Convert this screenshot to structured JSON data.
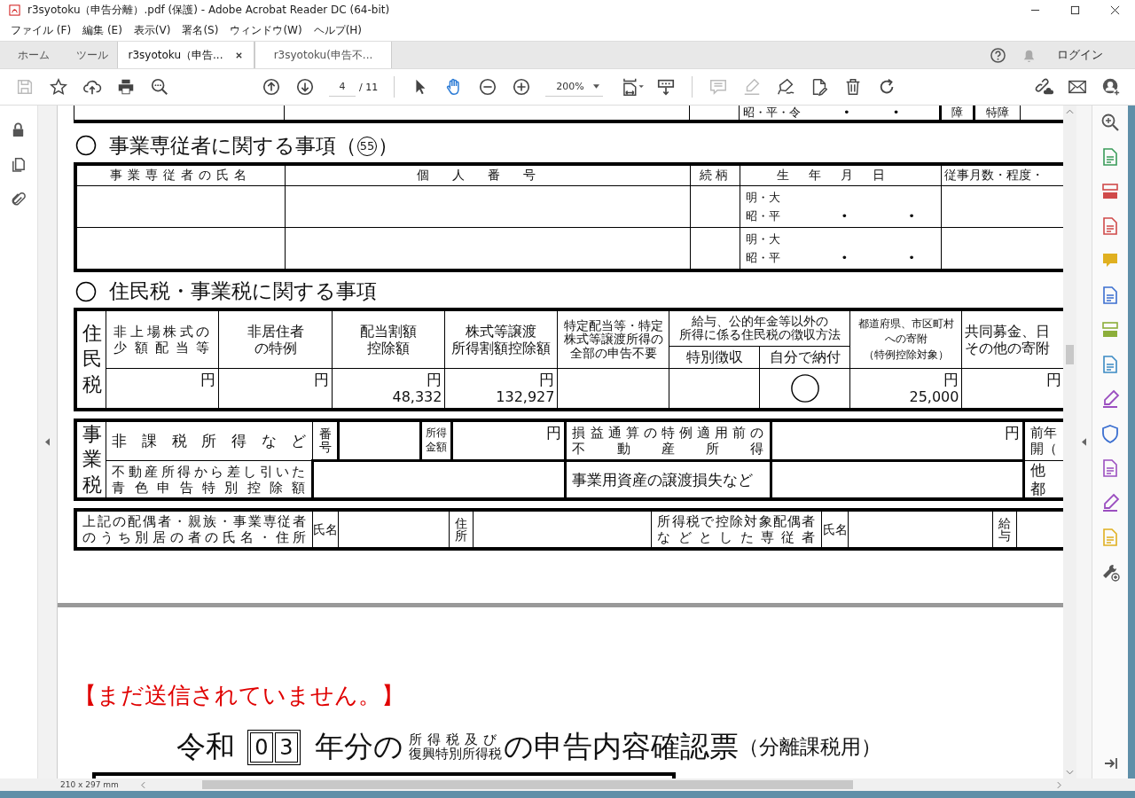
{
  "window": {
    "title": "r3syotoku（申告分離）.pdf (保護) - Adobe Acrobat Reader DC (64-bit)"
  },
  "menu": [
    "ファイル (F)",
    "編集 (E)",
    "表示(V)",
    "署名(S)",
    "ウィンドウ(W)",
    "ヘルプ(H)"
  ],
  "tabs": [
    {
      "label": "ホーム",
      "kind": "nav",
      "selected": false
    },
    {
      "label": "ツール",
      "kind": "nav",
      "selected": false
    },
    {
      "label": "r3syotoku（申告...",
      "kind": "doc",
      "selected": true
    },
    {
      "label": "r3syotoku(申告不...",
      "kind": "doc",
      "selected": false
    }
  ],
  "account": {
    "login": "ログイン"
  },
  "toolbar": {
    "page_number": "4",
    "page_count": "/ 11",
    "zoom": "200%",
    "tools": [
      {
        "kind": "select",
        "selected": false
      },
      {
        "kind": "hand",
        "selected": true
      }
    ]
  },
  "document": {
    "prev_row": {
      "era": "昭・平・令",
      "dots": [
        "•",
        "•"
      ],
      "flags": [
        "障",
        "特障"
      ]
    },
    "employees": {
      "title": "事業専従者に関する事項（",
      "ref": "55",
      "title_end": "）",
      "columns": [
        "事業専従者の氏名",
        "個人番号",
        "続柄",
        "生年月日",
        "従事月数・程度・"
      ],
      "rows": [
        {
          "era_1": "明・大",
          "era_2": "昭・平",
          "dots": [
            "•",
            "•"
          ]
        },
        {
          "era_1": "明・大",
          "era_2": "昭・平",
          "dots": [
            "•",
            "•"
          ]
        }
      ]
    },
    "local_tax": {
      "title": "住民税・事業税に関する事項",
      "resident": {
        "label": "住民税",
        "columns": [
          {
            "kind": "amount",
            "label": [
              "非上場株式の",
              "少額配当等"
            ],
            "unit": "円"
          },
          {
            "kind": "amount",
            "label": [
              "非居住者",
              "の特例"
            ],
            "unit": "円"
          },
          {
            "kind": "amount",
            "label": [
              "配当割額",
              "控除額"
            ],
            "unit": "円",
            "amount": "48,332"
          },
          {
            "kind": "amount",
            "label": [
              "株式等譲渡",
              "所得割額控除額"
            ],
            "unit": "円",
            "amount": "132,927"
          },
          {
            "kind": "check",
            "label": [
              "特定配当等・特定",
              "株式等譲渡所得の",
              "全部の申告不要"
            ]
          },
          {
            "kind": "choice",
            "label": [
              "給与、公的年金等以外の",
              "所得に係る住民税の徴収方法"
            ],
            "options": [
              {
                "label": "特別徴収",
                "circled": false
              },
              {
                "label": "自分で納付",
                "circled": true
              }
            ]
          },
          {
            "kind": "amount",
            "label": [
              "都道府県、市区町村",
              "への寄附",
              "（特例控除対象）"
            ],
            "unit": "円",
            "amount": "25,000"
          },
          {
            "kind": "amount",
            "label": [
              "共同募金、日",
              "その他の寄附"
            ],
            "unit": "円"
          }
        ]
      },
      "business": {
        "label": "事業税",
        "exempt_label": "非課税所得など",
        "number_label": "番号",
        "income_label": [
          "所得",
          "金額"
        ],
        "income_unit": "円",
        "pre_offset_label": [
          "損益通算の特例適用前の",
          "不動産所得"
        ],
        "pre_offset_unit": "円",
        "prev_year_label": [
          "前年",
          "開（"
        ],
        "blue_deduction_label": [
          "不動産所得から差し引いた",
          "青色申告特別控除額"
        ],
        "asset_loss_label": "事業用資産の譲渡損失など",
        "other_label": "他都"
      },
      "separate": {
        "label": [
          "上記の配偶者・親族・事業専従者",
          "のうち別居の者の氏名・住所"
        ],
        "name_label": "氏名",
        "address_label": "住所",
        "spouse_label": [
          "所得税で控除対象配偶者",
          "などとした専従者"
        ],
        "spouse_name_label": "氏名",
        "salary_label": "給与"
      }
    },
    "next_page": {
      "notice": "【まだ送信されていません。】",
      "era": "令和",
      "year_digits": [
        "0",
        "3"
      ],
      "year_suffix": "年分の",
      "tax_names": [
        "所得税及び",
        "復興特別所得税"
      ],
      "title": "の申告内容確認票",
      "subtitle": "（分離課税用）"
    }
  },
  "status_bar": {
    "page_size": "210 x 297 mm"
  }
}
